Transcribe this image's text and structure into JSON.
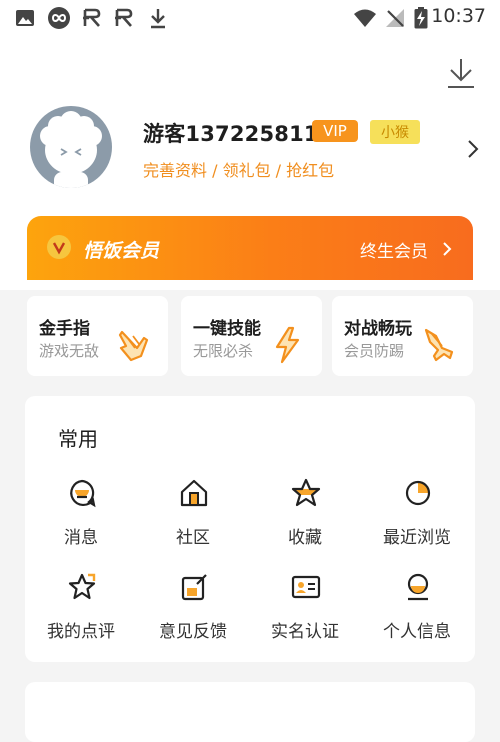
{
  "status_bar": {
    "time": "10:37",
    "icons": [
      "image-icon",
      "infinity-icon",
      "bug-icon",
      "bug-icon",
      "download-arrow-icon",
      "wifi-icon",
      "no-signal-icon",
      "battery-charging-icon"
    ]
  },
  "header": {
    "download_icon": "download-icon"
  },
  "profile": {
    "username": "游客137225811",
    "vip_badge": "VIP",
    "level_badge": "小猴",
    "links": "完善资料 / 领礼包 / 抢红包"
  },
  "membership": {
    "title": "悟饭会员",
    "action": "终生会员"
  },
  "features": [
    {
      "title": "金手指",
      "subtitle": "游戏无敌",
      "icon": "golden-finger-icon"
    },
    {
      "title": "一键技能",
      "subtitle": "无限必杀",
      "icon": "lightning-icon"
    },
    {
      "title": "对战畅玩",
      "subtitle": "会员防踢",
      "icon": "battle-plane-icon"
    }
  ],
  "common": {
    "title": "常用",
    "items": [
      {
        "label": "消息",
        "icon": "message-icon"
      },
      {
        "label": "社区",
        "icon": "community-icon"
      },
      {
        "label": "收藏",
        "icon": "favorite-icon"
      },
      {
        "label": "最近浏览",
        "icon": "recent-icon"
      },
      {
        "label": "我的点评",
        "icon": "review-icon"
      },
      {
        "label": "意见反馈",
        "icon": "feedback-icon"
      },
      {
        "label": "实名认证",
        "icon": "id-card-icon"
      },
      {
        "label": "个人信息",
        "icon": "personal-info-icon"
      }
    ]
  },
  "colors": {
    "accent": "#f7941d",
    "banner_start": "#fda40d",
    "banner_end": "#f86c1e",
    "link": "#f08e1f",
    "background": "#f4f4f4"
  }
}
